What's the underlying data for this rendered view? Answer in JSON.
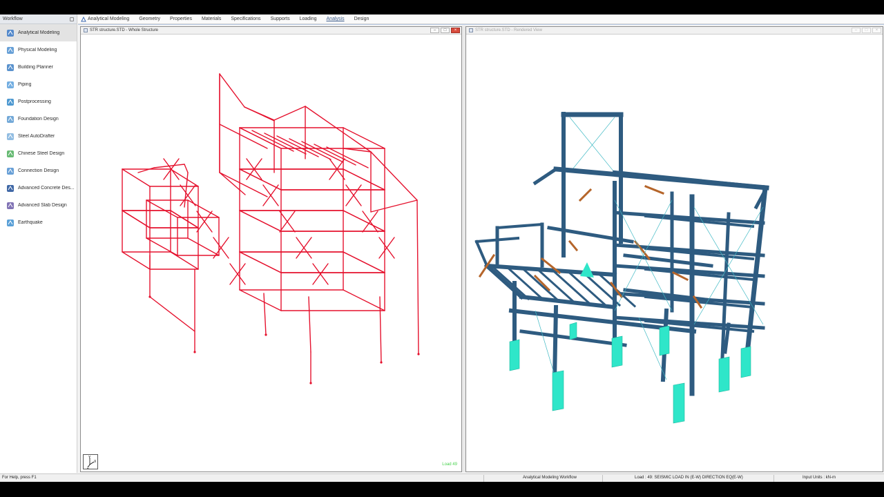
{
  "sidebar": {
    "title": "Workflow",
    "items": [
      {
        "label": "Analytical Modeling",
        "icon": "analytical-modeling-icon",
        "active": true
      },
      {
        "label": "Physical Modeling",
        "icon": "physical-modeling-icon"
      },
      {
        "label": "Building Planner",
        "icon": "building-planner-icon"
      },
      {
        "label": "Piping",
        "icon": "piping-icon"
      },
      {
        "label": "Postprocessing",
        "icon": "postprocessing-icon"
      },
      {
        "label": "Foundation Design",
        "icon": "foundation-design-icon"
      },
      {
        "label": "Steel AutoDrafter",
        "icon": "steel-autodrafter-icon"
      },
      {
        "label": "Chinese Steel Design",
        "icon": "chinese-steel-design-icon"
      },
      {
        "label": "Connection Design",
        "icon": "connection-design-icon"
      },
      {
        "label": "Advanced Concrete Des...",
        "icon": "advanced-concrete-design-icon"
      },
      {
        "label": "Advanced Slab Design",
        "icon": "advanced-slab-design-icon"
      },
      {
        "label": "Earthquake",
        "icon": "earthquake-icon"
      }
    ]
  },
  "tabs": [
    {
      "label": "Analytical Modeling"
    },
    {
      "label": "Geometry"
    },
    {
      "label": "Properties"
    },
    {
      "label": "Materials"
    },
    {
      "label": "Specifications"
    },
    {
      "label": "Supports"
    },
    {
      "label": "Loading"
    },
    {
      "label": "Analysis",
      "active": true
    },
    {
      "label": "Design"
    }
  ],
  "left_window": {
    "title": "STR structure.STD - Whole Structure",
    "load_label": "Load 49",
    "axis_labels": {
      "y": "Y",
      "x": "X",
      "z": "Z"
    }
  },
  "right_window": {
    "title": "STR structure.STD - Rendered View"
  },
  "status": {
    "help": "For Help, press F1",
    "workflow": "Analytical Modeling Workflow",
    "load": "Load : 49: SEISMIC LOAD IN (E-W) DIRECTION EQ(E-W)",
    "units": "Input Units : kN-m"
  },
  "colors": {
    "wireframe": "#e5112d",
    "steel": "#2e5b80",
    "pedestal": "#2fe6c9",
    "brace": "#b5652a"
  }
}
